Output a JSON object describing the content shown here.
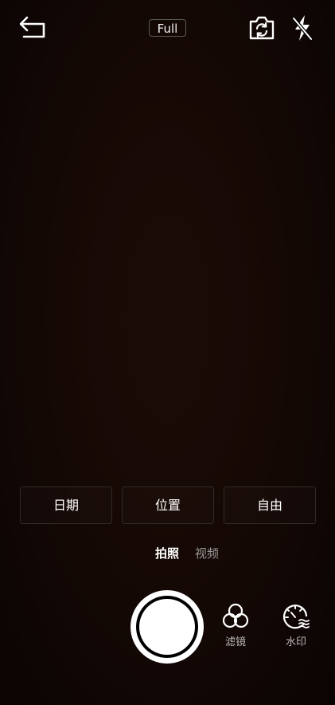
{
  "top_bar": {
    "back_icon": "back-arrow-icon",
    "aspect_label": "Full",
    "switch_camera_icon": "switch-camera-icon",
    "flash_icon": "flash-off-icon"
  },
  "options": [
    {
      "label": "日期"
    },
    {
      "label": "位置"
    },
    {
      "label": "自由"
    }
  ],
  "modes": {
    "active": "拍照",
    "inactive": "视频"
  },
  "tools": {
    "filter_label": "滤镜",
    "watermark_label": "水印"
  },
  "colors": {
    "accent": "#ffffff",
    "inactive_text": "#9a9a9a",
    "background": "#160905"
  }
}
